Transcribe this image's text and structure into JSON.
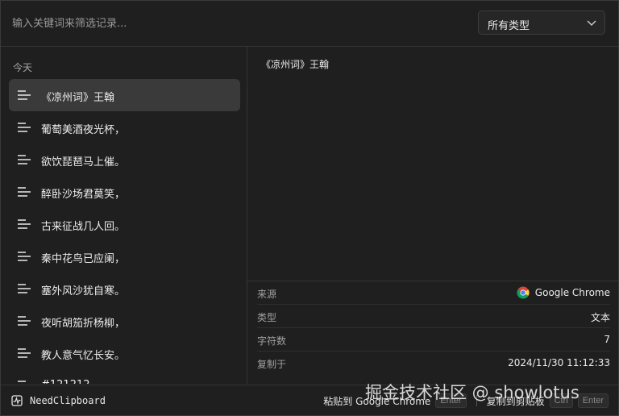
{
  "search": {
    "placeholder": "输入关键词来筛选记录..."
  },
  "type_filter": {
    "selected": "所有类型",
    "icon": "chevron-down-icon"
  },
  "history": {
    "section_label": "今天",
    "items": [
      {
        "text": "《凉州词》王翰",
        "active": true,
        "icon": "text-lines-icon"
      },
      {
        "text": "葡萄美酒夜光杯，",
        "active": false,
        "icon": "text-lines-icon"
      },
      {
        "text": "欲饮琵琶马上催。",
        "active": false,
        "icon": "text-lines-icon"
      },
      {
        "text": "醉卧沙场君莫笑，",
        "active": false,
        "icon": "text-lines-icon"
      },
      {
        "text": "古来征战几人回。",
        "active": false,
        "icon": "text-lines-icon"
      },
      {
        "text": "秦中花鸟已应阑，",
        "active": false,
        "icon": "text-lines-icon"
      },
      {
        "text": "塞外风沙犹自寒。",
        "active": false,
        "icon": "text-lines-icon"
      },
      {
        "text": "夜听胡笳折杨柳，",
        "active": false,
        "icon": "text-lines-icon"
      },
      {
        "text": "教人意气忆长安。",
        "active": false,
        "icon": "text-lines-icon"
      },
      {
        "text": "#121212",
        "active": false,
        "icon": "color-swatch-icon"
      }
    ]
  },
  "preview": {
    "content": "《凉州词》王翰"
  },
  "info": {
    "source_label": "来源",
    "source_value": "Google Chrome",
    "source_icon": "chrome-icon",
    "type_label": "类型",
    "type_value": "文本",
    "chars_label": "字符数",
    "chars_value": "7",
    "copied_label": "复制于",
    "copied_value": "2024/11/30 11:12:33"
  },
  "footer": {
    "app_name": "NeedClipboard",
    "paste_label": "粘贴到 Google Chrome",
    "paste_key": "Enter",
    "copy_label": "复制到剪贴板",
    "copy_key_1": "Ctrl",
    "copy_key_2": "Enter"
  },
  "watermark": "掘金技术社区 @ showlotus",
  "colors": {
    "background": "#1f1f1f",
    "active_item": "#3a3a3a",
    "border": "#343434"
  }
}
